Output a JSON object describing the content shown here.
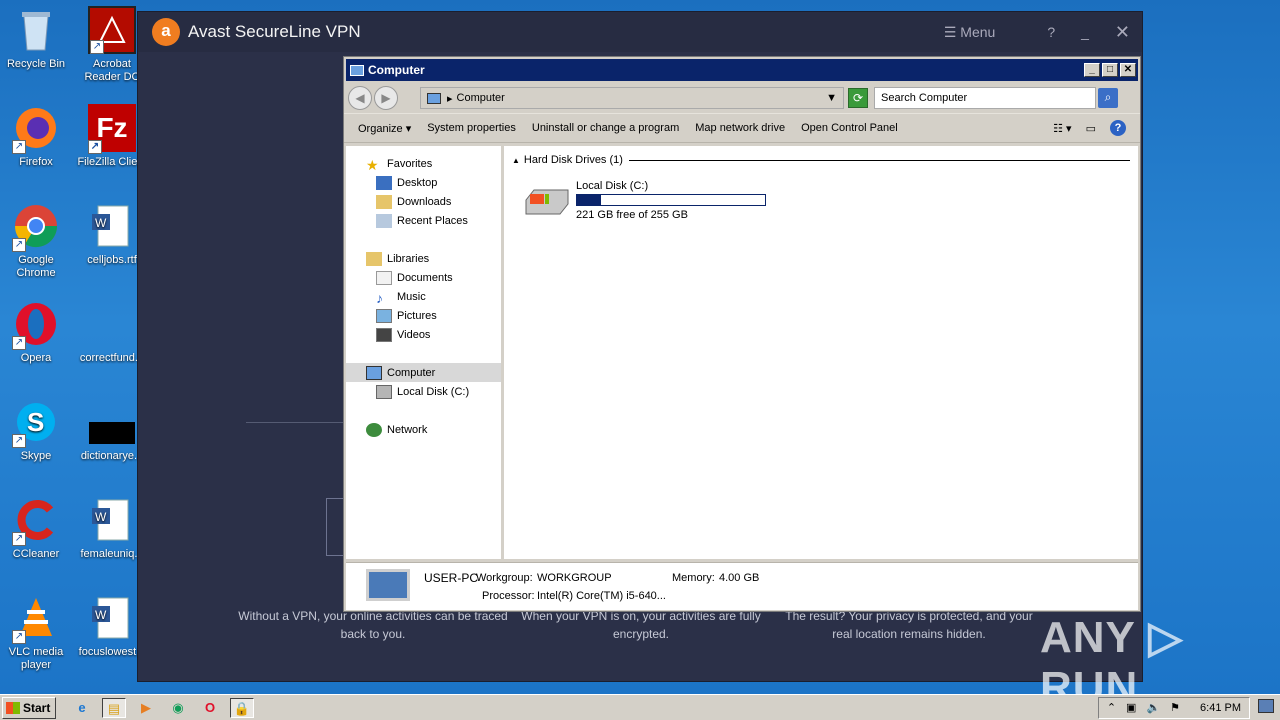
{
  "desktop": {
    "icons": [
      {
        "label": "Recycle Bin"
      },
      {
        "label": "Acrobat Reader DC"
      },
      {
        "label": "Firefox"
      },
      {
        "label": "FileZilla Client"
      },
      {
        "label": "Google Chrome"
      },
      {
        "label": "celljobs.rtf"
      },
      {
        "label": "Opera"
      },
      {
        "label": "correctfund..."
      },
      {
        "label": "Skype"
      },
      {
        "label": "dictionarye..."
      },
      {
        "label": "CCleaner"
      },
      {
        "label": "femaleuniq..."
      },
      {
        "label": "VLC media player"
      },
      {
        "label": "focuslowest..."
      }
    ]
  },
  "avast": {
    "title": "Avast SecureLine VPN",
    "menu_label": "Menu",
    "help": "?",
    "minimize": "_",
    "close": "✕",
    "footer": [
      "Without a VPN, your online activities can be traced back to you.",
      "When your VPN is on, your activities are fully encrypted.",
      "The result? Your privacy is protected, and your real location remains hidden."
    ]
  },
  "explorer": {
    "title": "Computer",
    "address": "Computer",
    "search_placeholder": "Search Computer",
    "toolbar": {
      "organize": "Organize",
      "system_properties": "System properties",
      "uninstall": "Uninstall or change a program",
      "map_drive": "Map network drive",
      "control_panel": "Open Control Panel"
    },
    "nav": {
      "favorites": "Favorites",
      "desktop": "Desktop",
      "downloads": "Downloads",
      "recent": "Recent Places",
      "libraries": "Libraries",
      "documents": "Documents",
      "music": "Music",
      "pictures": "Pictures",
      "videos": "Videos",
      "computer": "Computer",
      "local_disk": "Local Disk (C:)",
      "network": "Network"
    },
    "group_header": "Hard Disk Drives (1)",
    "disk": {
      "name": "Local Disk (C:)",
      "free_text": "221 GB free of 255 GB",
      "used_fraction": 0.13
    },
    "details": {
      "pc_name": "USER-PC",
      "workgroup_label": "Workgroup:",
      "workgroup": "WORKGROUP",
      "memory_label": "Memory:",
      "memory": "4.00 GB",
      "processor_label": "Processor:",
      "processor": "Intel(R) Core(TM) i5-640..."
    }
  },
  "taskbar": {
    "start": "Start",
    "time": "6:41 PM"
  },
  "watermark": "ANY ▷ RUN"
}
